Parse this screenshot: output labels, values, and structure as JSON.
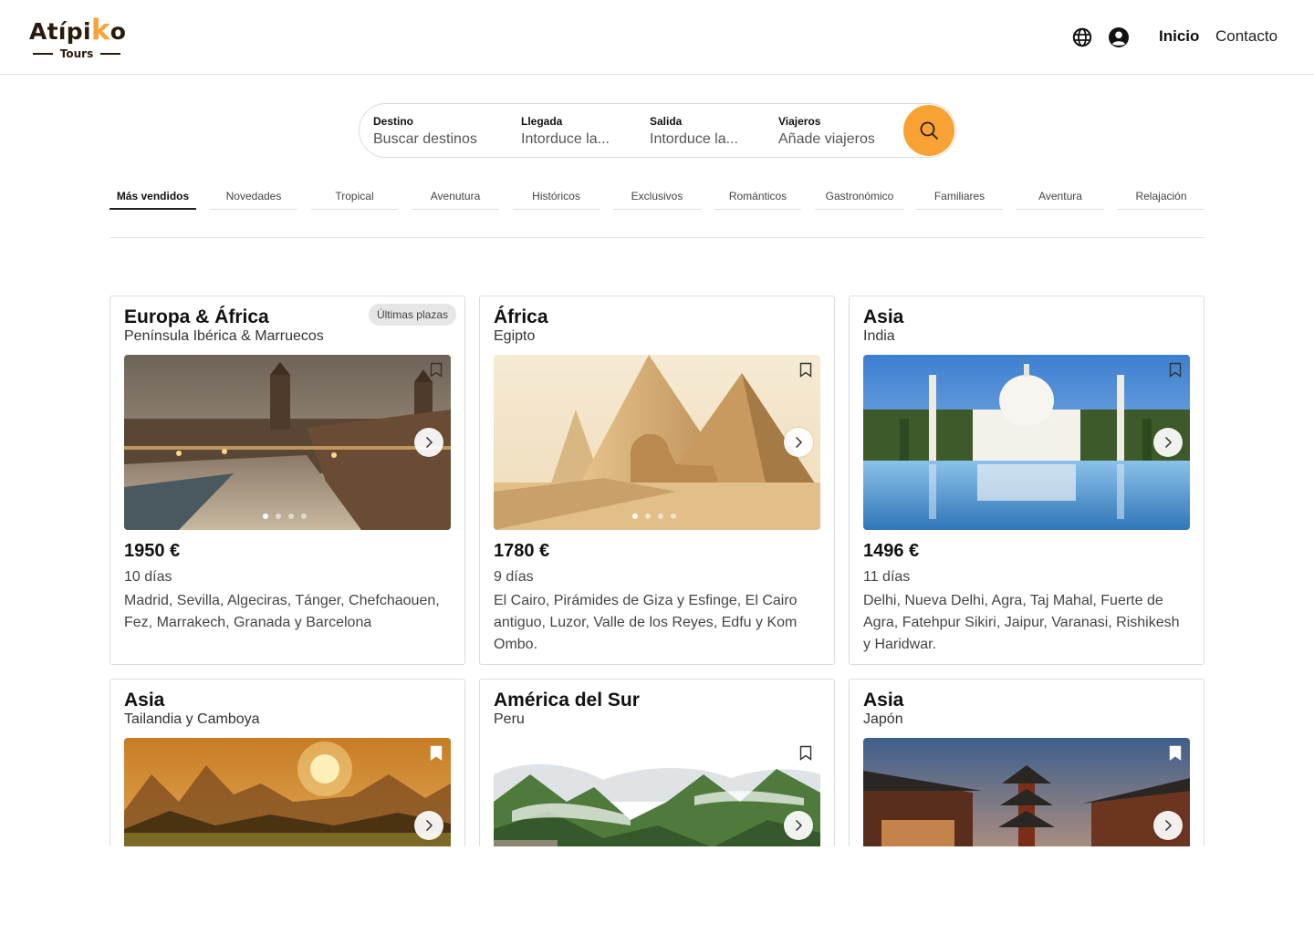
{
  "brand": {
    "name_prefix": "Atípi",
    "name_k": "k",
    "name_suffix": "o",
    "sub": "Tours",
    "accent": "#f7a23a"
  },
  "nav": {
    "language_icon": "globe-icon",
    "account_icon": "user-circle-icon",
    "links": [
      "Inicio",
      "Contacto"
    ]
  },
  "search": {
    "fields": [
      {
        "label": "Destino",
        "placeholder": "Buscar destinos"
      },
      {
        "label": "Llegada",
        "placeholder": "Intorduce la..."
      },
      {
        "label": "Salida",
        "placeholder": "Intorduce la..."
      },
      {
        "label": "Viajeros",
        "placeholder": "Añade viajeros"
      }
    ],
    "button_icon": "search-icon",
    "button_color": "#f8a233"
  },
  "tabs": [
    "Más vendidos",
    "Novedades",
    "Tropical",
    "Avenutura",
    "Históricos",
    "Exclusivos",
    "Románticos",
    "Gastronómico",
    "Familiares",
    "Aventura",
    "Relajación"
  ],
  "active_tab": "Más vendidos",
  "cards": [
    {
      "region": "Europa & África",
      "place": "Península Ibérica  & Marruecos",
      "badge": "Últimas plazas",
      "price": "1950 €",
      "days": "10 días",
      "route": "Madrid, Sevilla, Algeciras, Tánger, Chefchaouen, Fez, Marrakech, Granada y Barcelona"
    },
    {
      "region": "África",
      "place": "Egipto",
      "price": "1780 €",
      "days": "9 días",
      "route": "El Cairo, Pirámides de Giza y Esfinge, El Cairo antiguo, Luzor, Valle de los Reyes, Edfu y Kom Ombo."
    },
    {
      "region": "Asia",
      "place": "India",
      "price": "1496 €",
      "days": "11 días",
      "route": "Delhi, Nueva Delhi, Agra, Taj Mahal, Fuerte de Agra, Fatehpur Sikiri, Jaipur, Varanasi, Rishikesh y Haridwar."
    },
    {
      "region": "Asia",
      "place": "Tailandia y Camboya"
    },
    {
      "region": "América del Sur",
      "place": "Peru"
    },
    {
      "region": "Asia",
      "place": "Japón"
    }
  ]
}
